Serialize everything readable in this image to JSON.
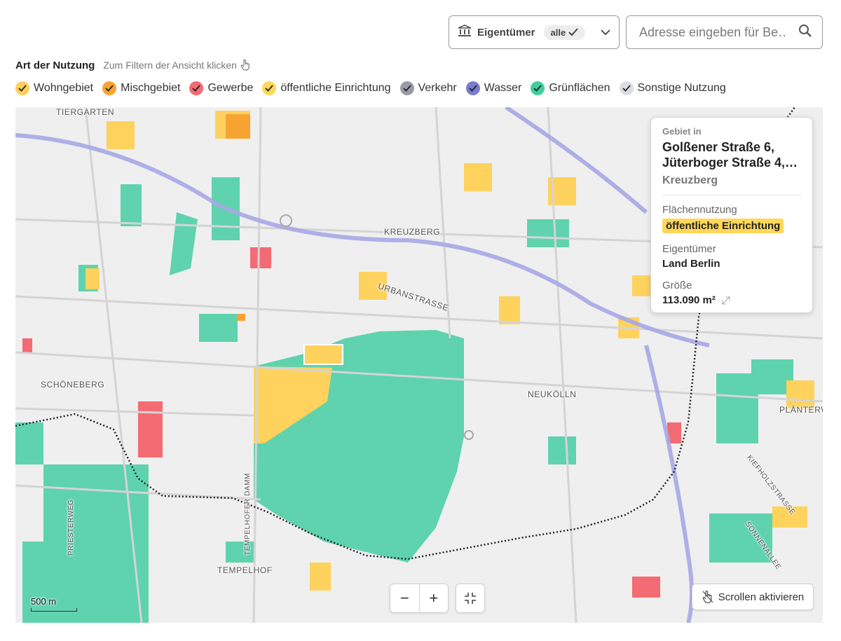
{
  "owner_filter": {
    "label": "Eigentümer",
    "selected": "alle",
    "icon": "building-icon"
  },
  "search": {
    "placeholder": "Adresse eingeben für Be…",
    "icon": "search-icon"
  },
  "filter": {
    "title": "Art der Nutzung",
    "hint": "Zum Filtern der Ansicht klicken",
    "hint_icon": "pointer-hand-icon"
  },
  "legend": [
    {
      "label": "Wohngebiet",
      "color": "#ffcf5c"
    },
    {
      "label": "Mischgebiet",
      "color": "#f7a331"
    },
    {
      "label": "Gewerbe",
      "color": "#f36b73"
    },
    {
      "label": "öffentliche Einrichtung",
      "color": "#ffd75a"
    },
    {
      "label": "Verkehr",
      "color": "#9b9ba6"
    },
    {
      "label": "Wasser",
      "color": "#7b7bd0"
    },
    {
      "label": "Grünflächen",
      "color": "#3fcf9f"
    },
    {
      "label": "Sonstige Nutzung",
      "color": "#dcdce6"
    }
  ],
  "map": {
    "labels": [
      "TIERGARTEN",
      "KREUZBERG",
      "URBANSTRASSE",
      "SCHÖNEBERG",
      "NEUKÖLLN",
      "PLÄNTERW",
      "KIEFHOLZSTRASSE",
      "TEMPELHOFER DAMM",
      "PRIESTERWEG",
      "SONNENALLEE",
      "TEMPELHOF"
    ],
    "scale_label": "500 m"
  },
  "info": {
    "kicker": "Gebiet in",
    "address_line1": "Golßener Straße 6,",
    "address_line2": "Jüterboger Straße 4,…",
    "district": "Kreuzberg",
    "usage_label": "Flächennutzung",
    "usage_value": "öffentliche Einrichtung",
    "owner_label": "Eigentümer",
    "owner_value": "Land Berlin",
    "size_label": "Größe",
    "size_value": "113.090 m²"
  },
  "controls": {
    "zoom_out": "−",
    "zoom_in": "+",
    "scroll_label": "Scrollen aktivieren"
  }
}
